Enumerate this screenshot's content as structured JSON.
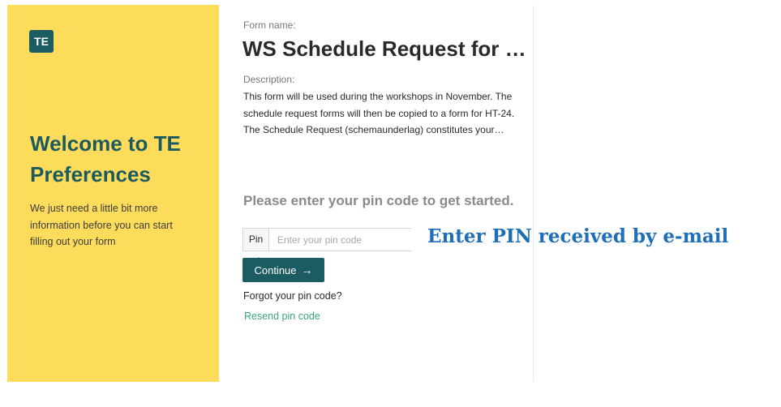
{
  "sidebar": {
    "logo_text": "TE",
    "title": "Welcome to TE Preferences",
    "text": "We just need a little bit more information before you can start filling out your form"
  },
  "form": {
    "name_label": "Form name:",
    "name": "WS Schedule Request for …",
    "description_label": "Description:",
    "description": "This form will be used during the workshops in November. The schedule request forms will then be copied to a form for HT-24. The Schedule Request (schemaunderlag) constitutes your…"
  },
  "pin": {
    "prompt": "Please enter your pin code to get started.",
    "label": "Pin code:",
    "placeholder": "Enter your pin code",
    "value": "",
    "continue_label": "Continue",
    "forgot_text": "Forgot your pin code?",
    "resend_label": "Resend pin code"
  },
  "annotation": {
    "text": "Enter PIN received by e-mail"
  },
  "colors": {
    "sidebar_bg": "#fddc5c",
    "brand": "#1b5c62",
    "link": "#3aa67c",
    "annotation": "#1f6fb8"
  },
  "icons": {
    "continue": "arrow-right-icon"
  }
}
